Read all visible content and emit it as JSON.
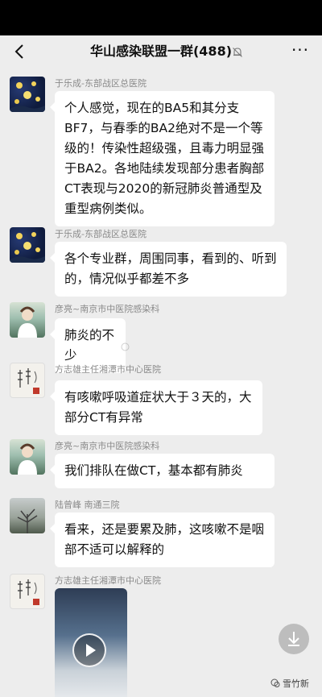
{
  "header": {
    "title": "华山感染联盟一群(488)",
    "back_icon": "chevron-left-icon",
    "mute_icon": "bell-slash-icon",
    "more_label": "···"
  },
  "messages": [
    {
      "sender": "于乐成-东部战区总医院",
      "avatar": "starry-night-avatar",
      "text": "个人感觉，现在的BA5和其分支BF7，与春季的BA2绝对不是一个等级的！传染性超级强，且毒力明显强于BA2。各地陆续发现部分患者胸部CT表现与2020的新冠肺炎普通型及重型病例类似。"
    },
    {
      "sender": "于乐成-东部战区总医院",
      "avatar": "starry-night-avatar",
      "text": "各个专业群，周围同事，看到的、听到的，情况似乎都差不多"
    },
    {
      "sender": "彦亮~南京市中医院感染科",
      "avatar": "photo-avatar",
      "text": "肺炎的不少"
    },
    {
      "sender": "方志雄主任湘潭市中心医院",
      "avatar": "calligraphy-avatar",
      "text": "有咳嗽呼吸道症状大于３天的，大部分CT有异常"
    },
    {
      "sender": "彦亮~南京市中医院感染科",
      "avatar": "photo-avatar",
      "text": "我们排队在做CT，基本都有肺炎"
    },
    {
      "sender": "陆曾峰 南通三院",
      "avatar": "tree-avatar",
      "text": "看来，还是要累及肺，这咳嗽不是咽部不适可以解释的"
    },
    {
      "sender": "方志雄主任湘潭市中心医院",
      "avatar": "calligraphy-avatar",
      "text": ""
    }
  ],
  "video": {
    "play_icon": "play-icon"
  },
  "footer": {
    "download_icon": "download-icon",
    "watermark": "雪竹新"
  },
  "colors": {
    "background": "#ededed",
    "bubble": "#ffffff",
    "status_bar": "#000000",
    "sender_text": "#8a8a8a"
  }
}
